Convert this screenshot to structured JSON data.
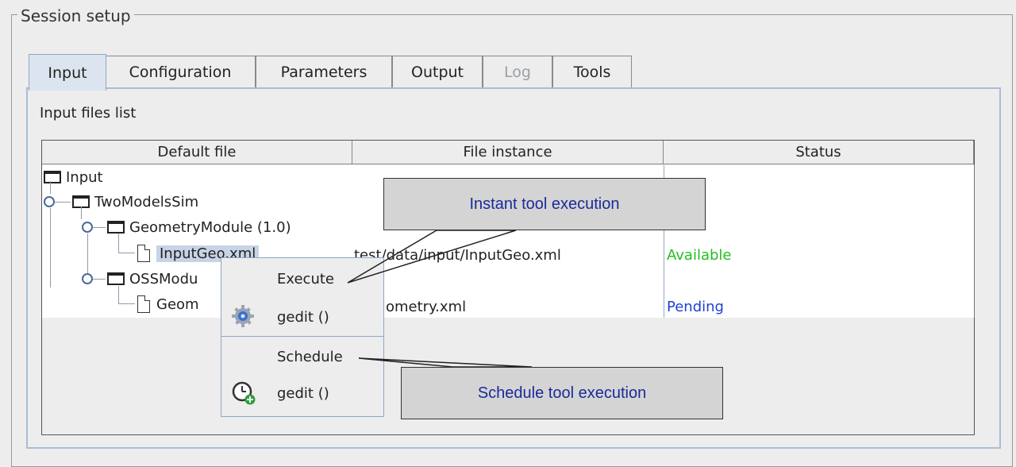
{
  "panel": {
    "title": "Session setup"
  },
  "tabs": [
    {
      "label": "Input",
      "active": true
    },
    {
      "label": "Configuration"
    },
    {
      "label": "Parameters"
    },
    {
      "label": "Output"
    },
    {
      "label": "Log",
      "disabled": true
    },
    {
      "label": "Tools"
    }
  ],
  "input_section": {
    "label": "Input files list"
  },
  "table": {
    "columns": [
      "Default file",
      "File instance",
      "Status"
    ],
    "tree": [
      {
        "label": "Input",
        "type": "folder"
      },
      {
        "label": "TwoModelsSim",
        "type": "folder"
      },
      {
        "label": "GeometryModule (1.0)",
        "type": "folder"
      },
      {
        "label": "InputGeo.xml",
        "type": "file",
        "instance": "test/data/input/InputGeo.xml",
        "status": "Available"
      },
      {
        "label": "OSSModu",
        "type": "folder"
      },
      {
        "label": "Geom",
        "type": "file",
        "instance": "ometry.xml",
        "status": "Pending"
      }
    ],
    "colors": {
      "available": "#21c021",
      "pending": "#1f3fd6"
    }
  },
  "context_menu": {
    "execute_header": "Execute",
    "execute_item": "gedit ()",
    "schedule_header": "Schedule",
    "schedule_item": "gedit ()"
  },
  "callouts": {
    "instant": "Instant tool execution",
    "schedule": "Schedule tool execution"
  }
}
